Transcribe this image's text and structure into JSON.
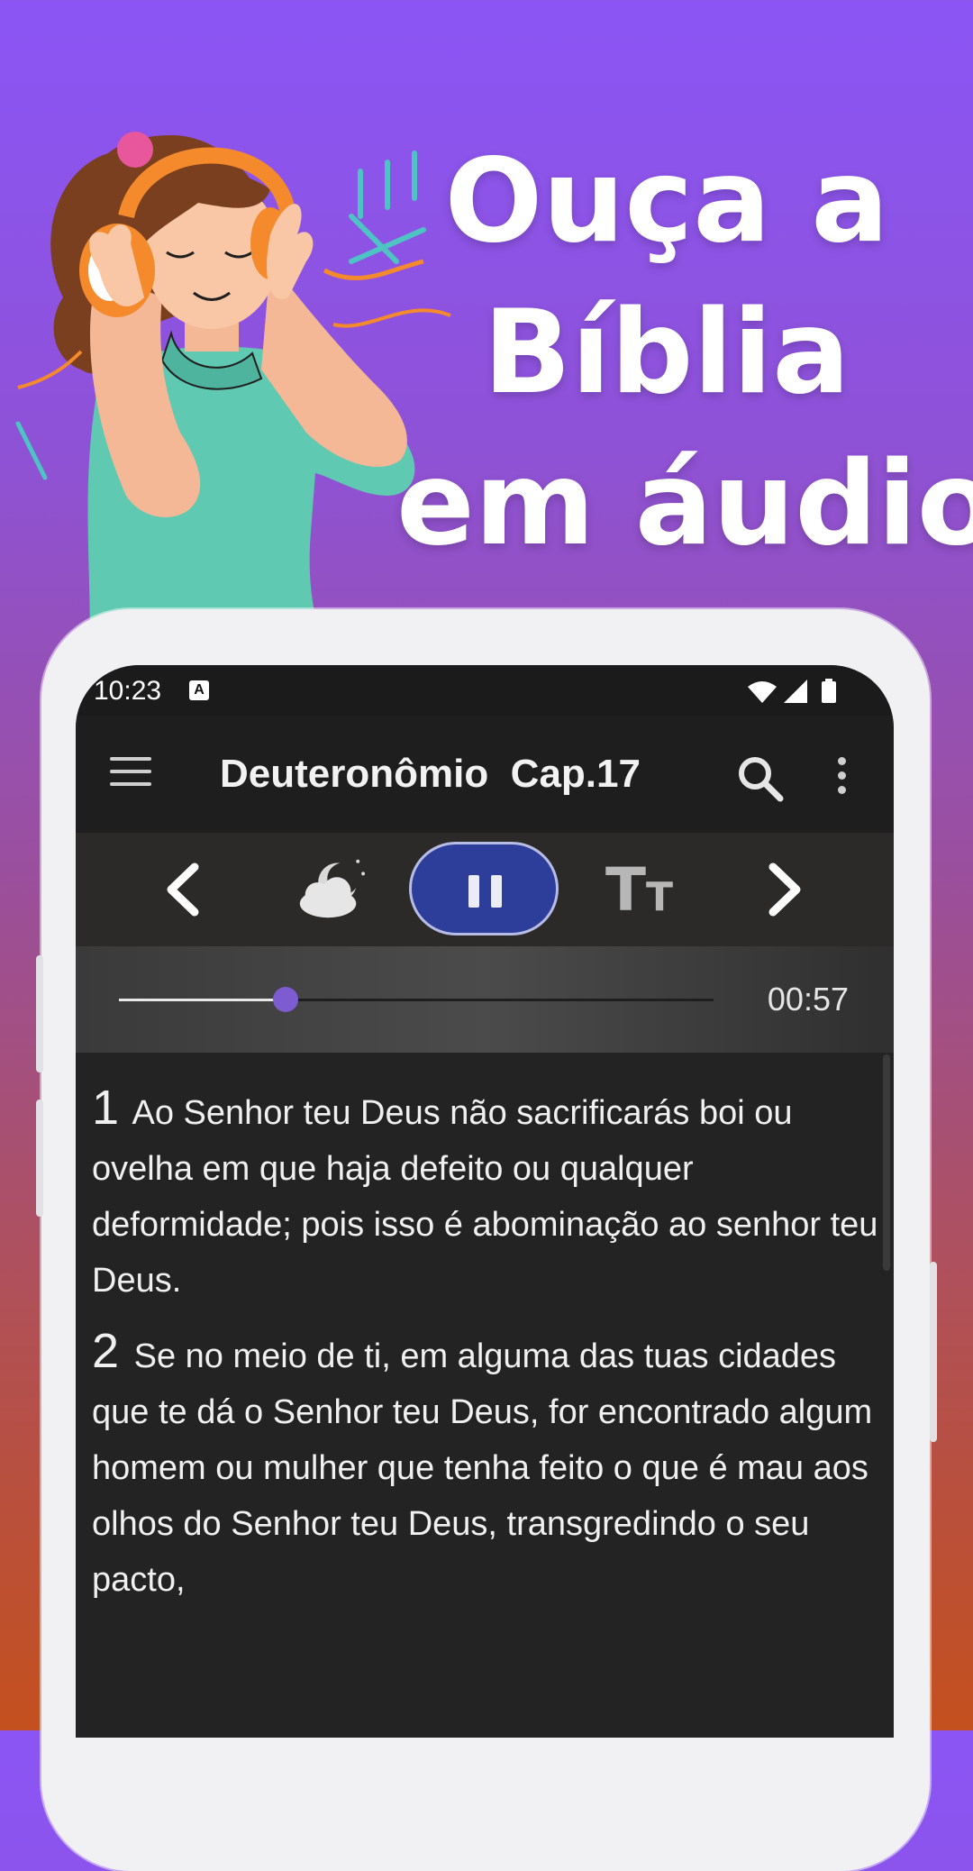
{
  "promo": {
    "headline_lines": [
      "Ouça a",
      "Bíblia",
      "em áudio"
    ]
  },
  "status_bar": {
    "time": "10:23",
    "notification_letter": "A"
  },
  "app_bar": {
    "title": "Deuteronômio  Cap.17",
    "menu_icon": "hamburger-menu-icon",
    "search_icon": "search-icon",
    "more_icon": "more-vertical-icon"
  },
  "player": {
    "prev_icon": "chevron-left-icon",
    "night_icon": "moon-cloud-icon",
    "pause_icon": "pause-icon",
    "text_size_glyph_big": "T",
    "text_size_glyph_small": "T",
    "next_icon": "chevron-right-icon",
    "progress_fraction": 0.28,
    "elapsed": "00:57",
    "accent_color": "#2d3d9a",
    "knob_color": "#7d5bd1"
  },
  "verses": [
    {
      "number": "1",
      "text": "Ao Senhor teu Deus não sacrificarás boi ou ovelha em que haja defeito ou qualquer deformidade; pois isso é abominação ao senhor teu Deus."
    },
    {
      "number": "2",
      "text": "Se no meio de ti, em alguma das tuas cidades que te dá o Senhor teu Deus, for encontrado algum homem ou mulher que tenha feito o que é mau aos olhos do Senhor teu Deus, transgredindo o seu pacto,"
    }
  ]
}
